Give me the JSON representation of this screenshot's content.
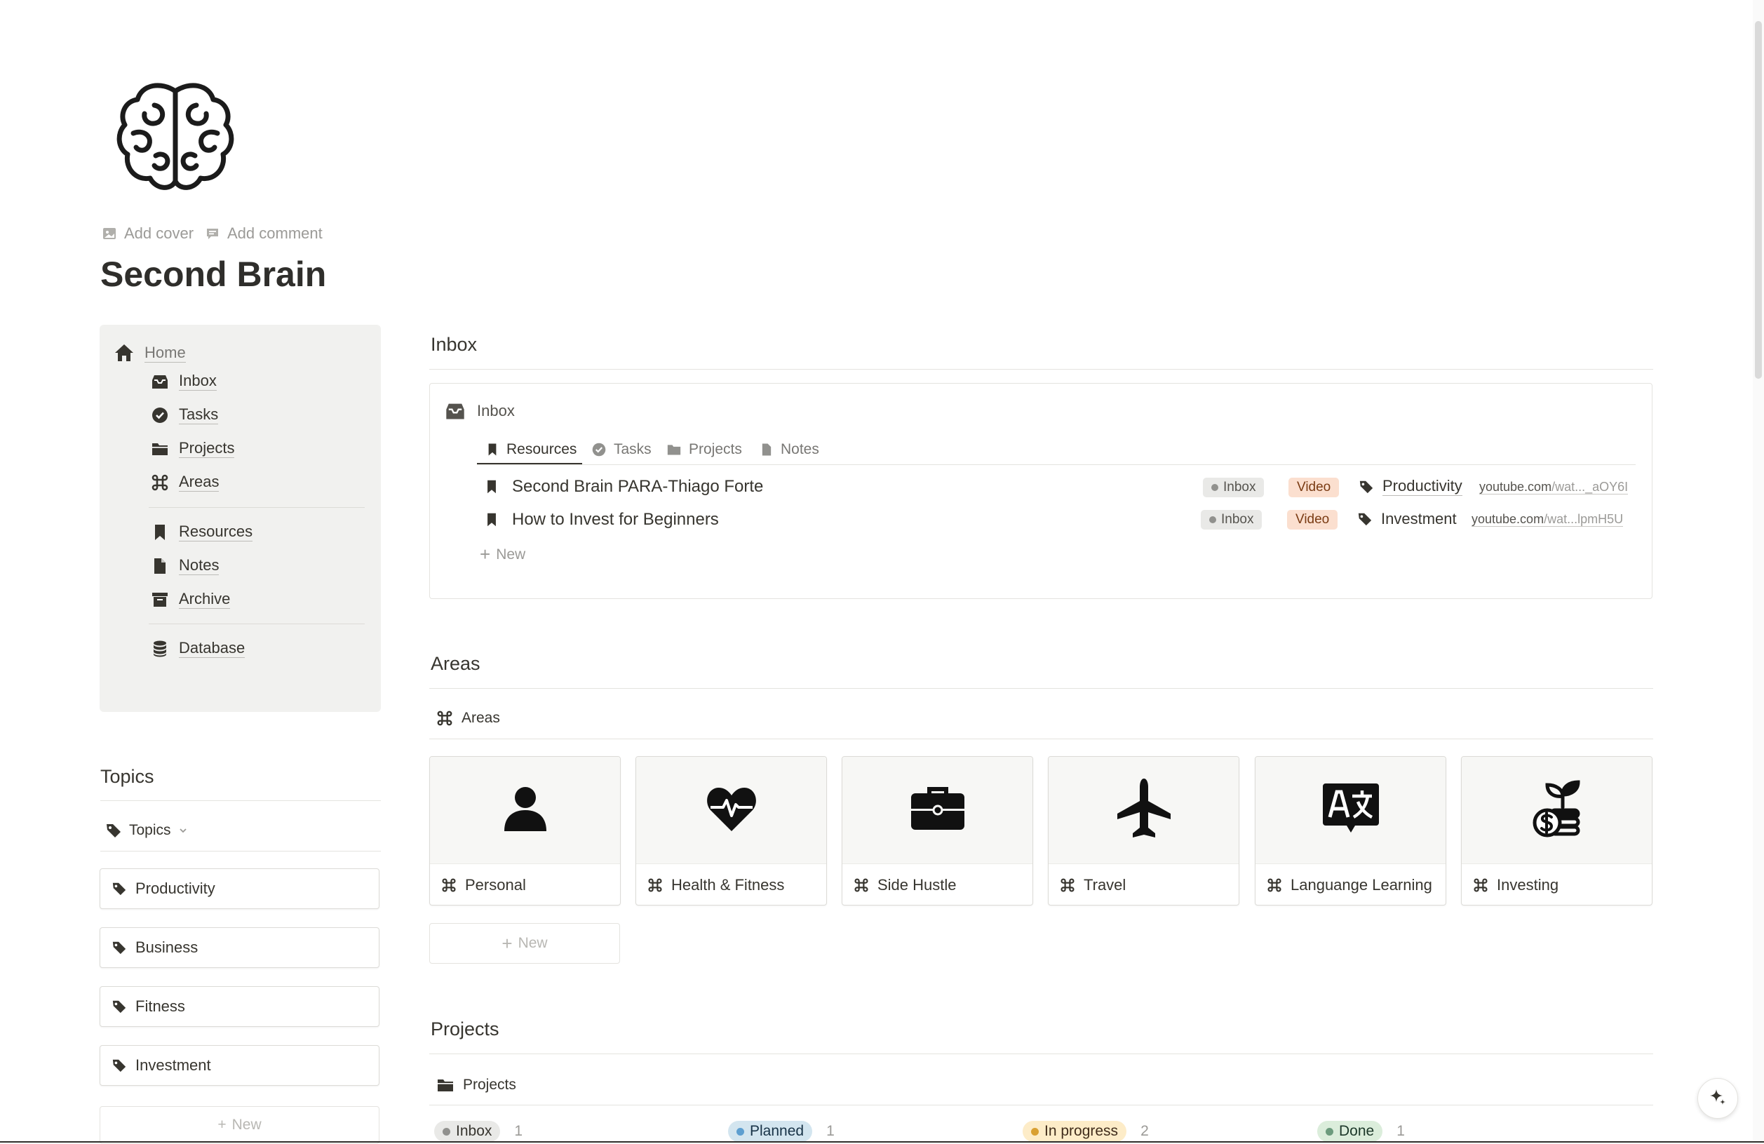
{
  "page": {
    "title": "Second Brain",
    "add_cover": "Add cover",
    "add_comment": "Add comment"
  },
  "nav": {
    "home": "Home",
    "items_group1": [
      "Inbox",
      "Tasks",
      "Projects",
      "Areas"
    ],
    "items_group2": [
      "Resources",
      "Notes",
      "Archive"
    ],
    "items_group3": [
      "Database"
    ]
  },
  "topics": {
    "heading": "Topics",
    "view_name": "Topics",
    "items": [
      "Productivity",
      "Business",
      "Fitness",
      "Investment"
    ],
    "new_label": "New"
  },
  "inbox": {
    "section_title": "Inbox",
    "db_title": "Inbox",
    "tabs": [
      "Resources",
      "Tasks",
      "Projects",
      "Notes"
    ],
    "active_tab": "Resources",
    "rows": [
      {
        "title": "Second Brain PARA-Thiago Forte",
        "status": "Inbox",
        "type": "Video",
        "topic": "Productivity",
        "url_domain": "youtube.com",
        "url_rest": "/wat..._aOY6I"
      },
      {
        "title": "How to Invest for Beginners",
        "status": "Inbox",
        "type": "Video",
        "topic": "Investment",
        "url_domain": "youtube.com",
        "url_rest": "/wat...lpmH5U"
      }
    ],
    "new_label": "New"
  },
  "areas": {
    "section_title": "Areas",
    "view_name": "Areas",
    "cards": [
      {
        "name": "Personal",
        "icon": "person-icon"
      },
      {
        "name": "Health & Fitness",
        "icon": "heart-pulse-icon"
      },
      {
        "name": "Side Hustle",
        "icon": "briefcase-icon"
      },
      {
        "name": "Travel",
        "icon": "airplane-icon"
      },
      {
        "name": "Languange Learning",
        "icon": "translate-icon"
      },
      {
        "name": "Investing",
        "icon": "money-plant-icon"
      }
    ],
    "new_label": "New"
  },
  "projects": {
    "section_title": "Projects",
    "view_name": "Projects",
    "groups": [
      {
        "label": "Inbox",
        "count": "1",
        "bg": "#e9e9e7",
        "dot": "#91918e",
        "color": "#37352f"
      },
      {
        "label": "Planned",
        "count": "1",
        "bg": "#d3e5ef",
        "dot": "#5e9fd0",
        "color": "#183347"
      },
      {
        "label": "In progress",
        "count": "2",
        "bg": "#fdecc8",
        "dot": "#d9a032",
        "color": "#402c1b"
      },
      {
        "label": "Done",
        "count": "1",
        "bg": "#dbeddb",
        "dot": "#6c9b7d",
        "color": "#1c3829"
      }
    ]
  },
  "colors": {
    "text": "#37352f",
    "muted": "#9b9a97",
    "nav_bg": "#f1f1ef",
    "video_tag": "#fbdfcf"
  }
}
